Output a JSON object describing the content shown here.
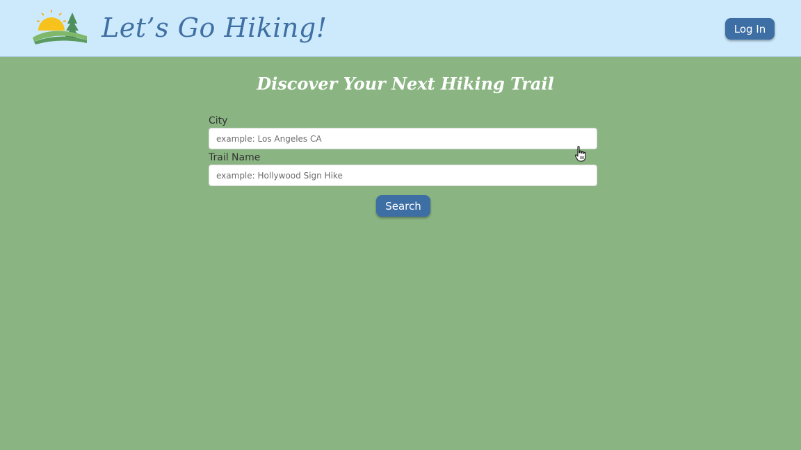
{
  "header": {
    "site_title": "Let’s Go Hiking!",
    "login_label": "Log In",
    "logo_icon": "sun-hills-tree-logo"
  },
  "main": {
    "heading": "Discover Your Next Hiking Trail",
    "city": {
      "label": "City",
      "placeholder": "example: Los Angeles CA",
      "value": ""
    },
    "trail": {
      "label": "Trail Name",
      "placeholder": "example: Hollywood Sign Hike",
      "value": ""
    },
    "search_label": "Search"
  },
  "colors": {
    "header_bg": "#cdeafc",
    "page_bg": "#8ab582",
    "accent": "#3d6ea4",
    "title_text": "#3f6fa3"
  },
  "cursor_icon": "hand-pointer-icon"
}
